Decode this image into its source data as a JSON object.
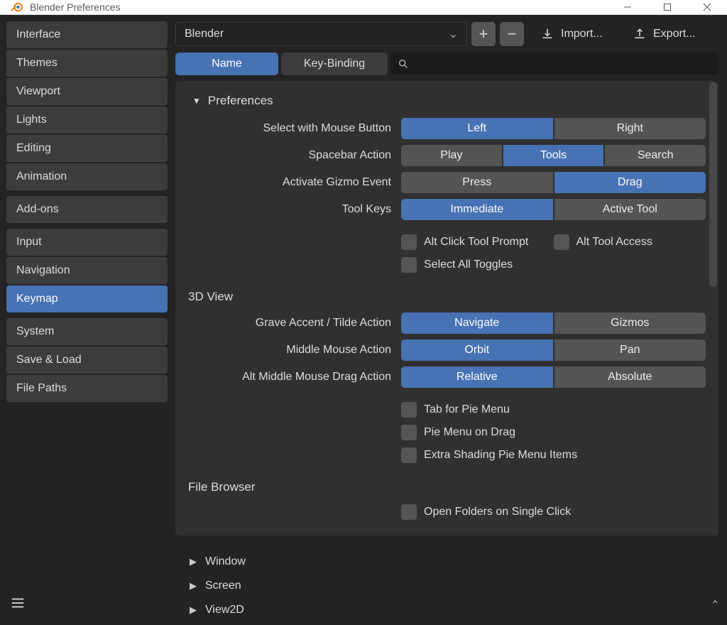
{
  "window": {
    "title": "Blender Preferences"
  },
  "sidebar": {
    "groups": [
      {
        "items": [
          {
            "label": "Interface"
          },
          {
            "label": "Themes"
          },
          {
            "label": "Viewport"
          },
          {
            "label": "Lights"
          },
          {
            "label": "Editing"
          },
          {
            "label": "Animation"
          }
        ]
      },
      {
        "items": [
          {
            "label": "Add-ons"
          }
        ]
      },
      {
        "items": [
          {
            "label": "Input"
          },
          {
            "label": "Navigation"
          },
          {
            "label": "Keymap",
            "active": true
          }
        ]
      },
      {
        "items": [
          {
            "label": "System"
          },
          {
            "label": "Save & Load"
          },
          {
            "label": "File Paths"
          }
        ]
      }
    ]
  },
  "top": {
    "preset": "Blender",
    "import": "Import...",
    "export": "Export..."
  },
  "tabs": {
    "name": "Name",
    "keybinding": "Key-Binding"
  },
  "pref": {
    "header": "Preferences",
    "rows": {
      "selectWith": {
        "label": "Select with Mouse Button",
        "opts": [
          "Left",
          "Right"
        ],
        "sel": 0
      },
      "spacebar": {
        "label": "Spacebar Action",
        "opts": [
          "Play",
          "Tools",
          "Search"
        ],
        "sel": 1
      },
      "gizmo": {
        "label": "Activate Gizmo Event",
        "opts": [
          "Press",
          "Drag"
        ],
        "sel": 1
      },
      "toolkeys": {
        "label": "Tool Keys",
        "opts": [
          "Immediate",
          "Active Tool"
        ],
        "sel": 0
      }
    },
    "checks1": [
      {
        "label": "Alt Click Tool Prompt"
      },
      {
        "label": "Alt Tool Access"
      },
      {
        "label": "Select All Toggles"
      }
    ],
    "view3d": {
      "title": "3D View",
      "rows": {
        "grave": {
          "label": "Grave Accent / Tilde Action",
          "opts": [
            "Navigate",
            "Gizmos"
          ],
          "sel": 0
        },
        "middle": {
          "label": "Middle Mouse Action",
          "opts": [
            "Orbit",
            "Pan"
          ],
          "sel": 0
        },
        "altmid": {
          "label": "Alt Middle Mouse Drag Action",
          "opts": [
            "Relative",
            "Absolute"
          ],
          "sel": 0
        }
      },
      "checks": [
        {
          "label": "Tab for Pie Menu"
        },
        {
          "label": "Pie Menu on Drag"
        },
        {
          "label": "Extra Shading Pie Menu Items"
        }
      ]
    },
    "fileBrowser": {
      "title": "File Browser",
      "checks": [
        {
          "label": "Open Folders on Single Click"
        }
      ]
    }
  },
  "afterSections": [
    "Window",
    "Screen",
    "View2D"
  ]
}
